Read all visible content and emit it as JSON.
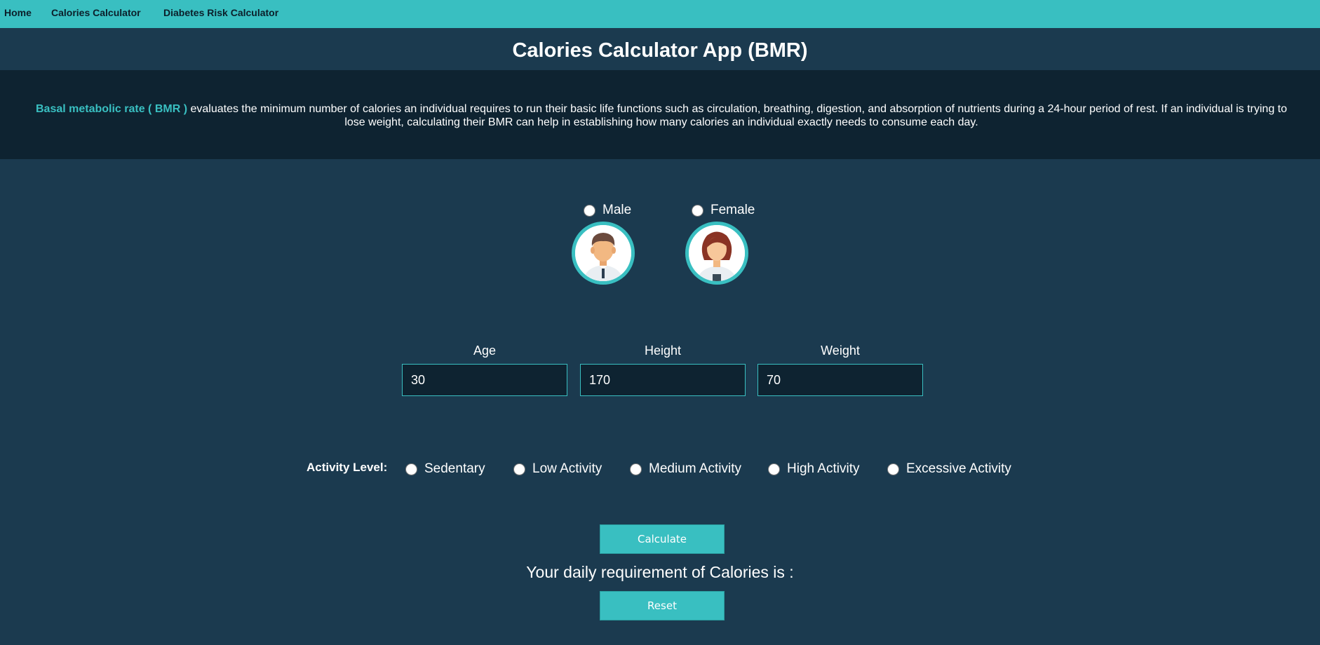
{
  "nav": {
    "items": [
      {
        "label": "Home"
      },
      {
        "label": "Calories Calculator"
      },
      {
        "label": "Diabetes Risk Calculator"
      }
    ]
  },
  "page": {
    "title": "Calories Calculator App (BMR)"
  },
  "intro": {
    "highlight": "Basal metabolic rate ( BMR )",
    "text": " evaluates the minimum number of calories an individual requires to run their basic life functions such as circulation, breathing, digestion, and absorption of nutrients during a 24-hour period of rest. If an individual is trying to lose weight, calculating their BMR can help in establishing how many calories an individual exactly needs to consume each day."
  },
  "gender": {
    "options": [
      {
        "label": "Male",
        "icon": "male-avatar-icon"
      },
      {
        "label": "Female",
        "icon": "female-avatar-icon"
      }
    ]
  },
  "fields": {
    "age": {
      "label": "Age",
      "value": "30"
    },
    "height": {
      "label": "Height",
      "value": "170"
    },
    "weight": {
      "label": "Weight",
      "value": "70"
    }
  },
  "activity": {
    "title": "Activity Level:",
    "options": [
      {
        "label": "Sedentary"
      },
      {
        "label": "Low Activity"
      },
      {
        "label": "Medium Activity"
      },
      {
        "label": "High Activity"
      },
      {
        "label": "Excessive Activity"
      }
    ]
  },
  "actions": {
    "calculate_label": "Calculate",
    "reset_label": "Reset"
  },
  "result": {
    "text": "Your daily requirement of Calories is :"
  },
  "colors": {
    "accent": "#39bfc1",
    "background": "#1b3a4f",
    "band": "#0e2331",
    "text": "#ffffff"
  }
}
